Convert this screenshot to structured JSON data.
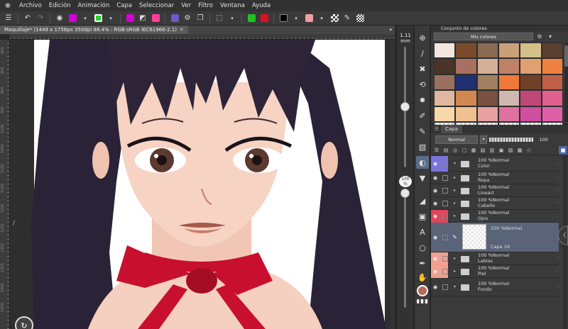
{
  "menu": {
    "items": [
      "Archivo",
      "Edición",
      "Animación",
      "Capa",
      "Seleccionar",
      "Ver",
      "Filtro",
      "Ventana",
      "Ayuda"
    ]
  },
  "canvas_tab": {
    "title": "Maquillaje* (1449 x 1758px 350dpi 88.4% : RGB:sRGB IEC61966-2.1)"
  },
  "ruler": {
    "left_numbers": [
      "800",
      "850",
      "900",
      "950",
      "1000",
      "1050",
      "1100",
      "1150",
      "1200",
      "1250",
      "1300",
      "1350",
      "1400",
      "1450"
    ]
  },
  "brush": {
    "size_value": "1.11",
    "size_unit": "mm",
    "opacity_value": "100",
    "opacity_unit": "%"
  },
  "color_set": {
    "panel_title": "Conjunto de colores",
    "selected_set": "Mis colores",
    "swatches": [
      "#f4e6df",
      "#7a4b2a",
      "#8a6a52",
      "#c8a07a",
      "#d6c08a",
      "#5a4030",
      "#4a3428",
      "#a87060",
      "#d4b098",
      "#c08068",
      "#e0a070",
      "#f08040",
      "#9a7060",
      "#203070",
      "#a08060",
      "#f07838",
      "#704028",
      "#c06048",
      "#e0b8a0",
      "#d08850",
      "#7a5040",
      "#d0b8b0",
      "#c04878",
      "#e06090",
      "#f8d8a8",
      "#f0c090",
      "#e8a0a0",
      "#e070a0",
      "#d050a0",
      "#e060a8"
    ],
    "transparent_rows": 1
  },
  "layer_panel": {
    "tab_label": "Capa",
    "blend_mode": "Normal",
    "opacity": "100",
    "layers": [
      {
        "line1": "100 %Normal",
        "line2": "Color",
        "type": "folder",
        "tag": "#7a73d8",
        "open": true,
        "visible": true
      },
      {
        "line1": "100 %Normal",
        "line2": "Ropa",
        "type": "folder",
        "tag": "",
        "open": false,
        "visible": true
      },
      {
        "line1": "100 %Normal",
        "line2": "Lineart",
        "type": "folder",
        "tag": "",
        "open": false,
        "visible": true
      },
      {
        "line1": "100 %Normal",
        "line2": "Cabello",
        "type": "folder",
        "tag": "",
        "open": false,
        "visible": true
      },
      {
        "line1": "100 %Normal",
        "line2": "Ojos",
        "type": "folder",
        "tag": "#e0455a",
        "open": false,
        "visible": true
      },
      {
        "line1": "100 %Normal",
        "line2": "Capa 16",
        "type": "raster",
        "tag": "",
        "open": false,
        "visible": true,
        "selected": true
      },
      {
        "line1": "100 %Normal",
        "line2": "Labios",
        "type": "folder",
        "tag": "#f0a090",
        "open": false,
        "visible": true
      },
      {
        "line1": "100 %Normal",
        "line2": "Piel",
        "type": "folder",
        "tag": "#f0a090",
        "open": false,
        "visible": true
      },
      {
        "line1": "100 %Normal",
        "line2": "Fondo",
        "type": "folder",
        "tag": "",
        "open": true,
        "visible": true
      }
    ]
  },
  "colors": {
    "main_color": "#b86a58",
    "layer_tag_purple": "#7a73d8",
    "layer_tag_red": "#e0455a",
    "layer_tag_peach": "#f0a090",
    "bow_red": "#c8102e",
    "hair": "#2a2236"
  },
  "icons": {
    "logo": "clip-studio-logo-icon",
    "rotate": "rotate-canvas-icon"
  }
}
